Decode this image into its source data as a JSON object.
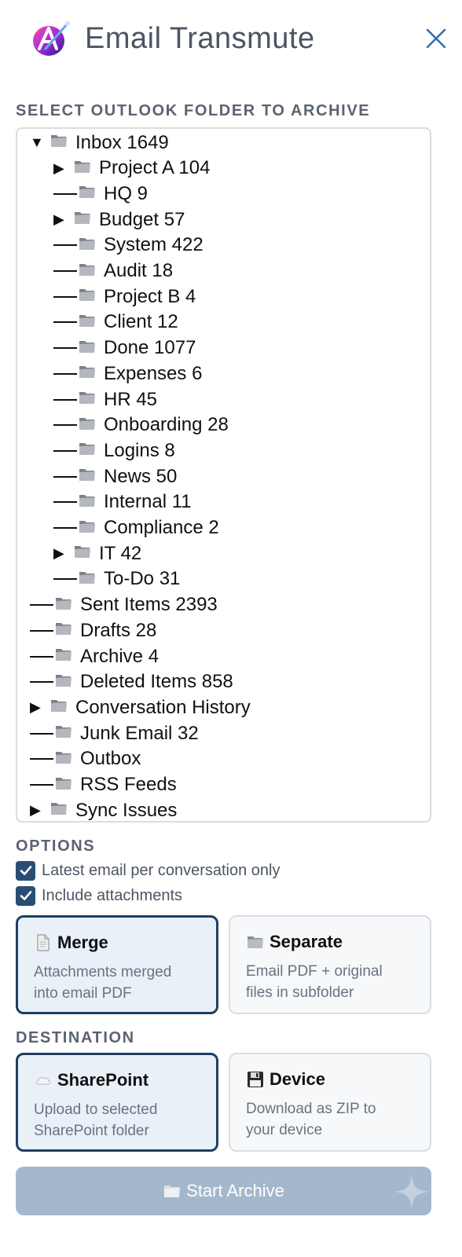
{
  "header": {
    "title": "Email Transmute",
    "logo_icon": "app-logo",
    "close_icon": "close-icon"
  },
  "folder_section": {
    "label": "SELECT OUTLOOK FOLDER TO ARCHIVE",
    "folders": [
      {
        "label": "Inbox 1649",
        "level": 0,
        "expander": "expanded"
      },
      {
        "label": "Project A 104",
        "level": 1,
        "expander": "collapsed"
      },
      {
        "label": "HQ 9",
        "level": 1,
        "expander": "none"
      },
      {
        "label": "Budget 57",
        "level": 1,
        "expander": "collapsed"
      },
      {
        "label": "System 422",
        "level": 1,
        "expander": "none"
      },
      {
        "label": "Audit 18",
        "level": 1,
        "expander": "none"
      },
      {
        "label": "Project B 4",
        "level": 1,
        "expander": "none"
      },
      {
        "label": "Client 12",
        "level": 1,
        "expander": "none"
      },
      {
        "label": "Done 1077",
        "level": 1,
        "expander": "none"
      },
      {
        "label": "Expenses 6",
        "level": 1,
        "expander": "none"
      },
      {
        "label": "HR 45",
        "level": 1,
        "expander": "none"
      },
      {
        "label": "Onboarding 28",
        "level": 1,
        "expander": "none"
      },
      {
        "label": "Logins 8",
        "level": 1,
        "expander": "none"
      },
      {
        "label": "News 50",
        "level": 1,
        "expander": "none"
      },
      {
        "label": "Internal 11",
        "level": 1,
        "expander": "none"
      },
      {
        "label": "Compliance 2",
        "level": 1,
        "expander": "none"
      },
      {
        "label": "IT 42",
        "level": 1,
        "expander": "collapsed"
      },
      {
        "label": "To-Do 31",
        "level": 1,
        "expander": "none"
      },
      {
        "label": "Sent Items 2393",
        "level": 0,
        "expander": "none"
      },
      {
        "label": "Drafts 28",
        "level": 0,
        "expander": "none"
      },
      {
        "label": "Archive 4",
        "level": 0,
        "expander": "none"
      },
      {
        "label": "Deleted Items 858",
        "level": 0,
        "expander": "none"
      },
      {
        "label": "Conversation History",
        "level": 0,
        "expander": "collapsed"
      },
      {
        "label": "Junk Email 32",
        "level": 0,
        "expander": "none"
      },
      {
        "label": "Outbox",
        "level": 0,
        "expander": "none"
      },
      {
        "label": "RSS Feeds",
        "level": 0,
        "expander": "none"
      },
      {
        "label": "Sync Issues",
        "level": 0,
        "expander": "collapsed"
      }
    ]
  },
  "options": {
    "label": "OPTIONS",
    "latest_email_label": "Latest email per conversation only",
    "latest_email_checked": true,
    "include_attachments_label": "Include attachments",
    "include_attachments_checked": true,
    "merge": {
      "title": "Merge",
      "desc1": "Attachments merged",
      "desc2": "into email PDF",
      "icon": "document-icon",
      "selected": true
    },
    "separate": {
      "title": "Separate",
      "desc1": "Email PDF + original",
      "desc2": "files in subfolder",
      "icon": "folder-icon",
      "selected": false
    }
  },
  "destination": {
    "label": "DESTINATION",
    "sharepoint": {
      "title": "SharePoint",
      "desc1": "Upload to selected",
      "desc2": "SharePoint folder",
      "icon": "cloud-icon",
      "selected": true
    },
    "device": {
      "title": "Device",
      "desc1": "Download as ZIP to",
      "desc2": "your device",
      "icon": "floppy-disk-icon",
      "selected": false
    }
  },
  "start_button": {
    "label": "Start Archive",
    "icon": "folder-icon"
  },
  "colors": {
    "accent": "#1e3f62",
    "checkbox": "#2a4e73",
    "button_disabled": "#a4b8cc",
    "selected_card_bg": "#e9f0f8"
  }
}
